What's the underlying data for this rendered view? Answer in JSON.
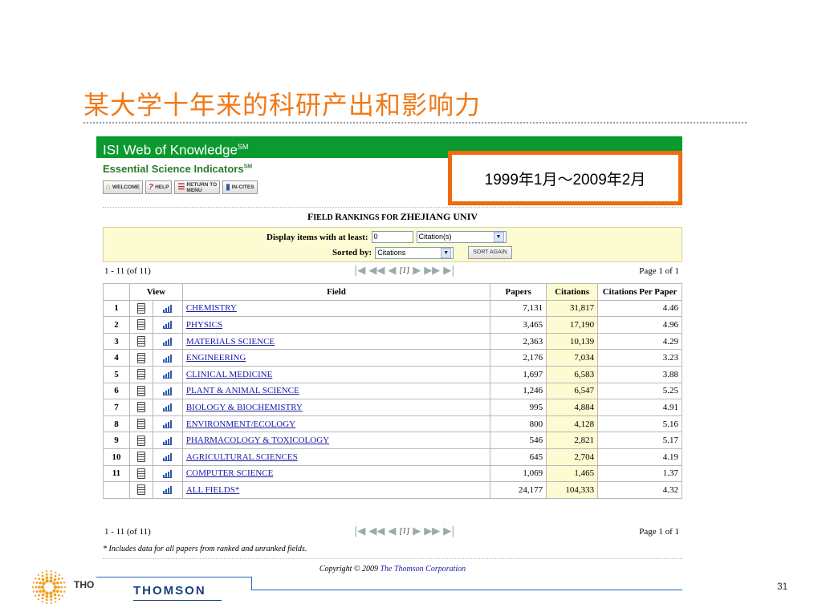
{
  "slide": {
    "title": "某大学十年来的科研产出和影响力",
    "date_range": "1999年1月～2009年2月",
    "page_number": "31"
  },
  "isi": {
    "title": "ISI Web of Knowledge",
    "title_mark": "SM",
    "subtitle": "Essential Science Indicators",
    "subtitle_mark": "SM",
    "buttons": [
      {
        "label": "WELCOME",
        "icon": "home-icon"
      },
      {
        "label": "HELP",
        "icon": "question-icon"
      },
      {
        "label_line1": "RETURN TO",
        "label_line2": "MENU",
        "icon": "menu-icon"
      },
      {
        "label": "IN-CITES",
        "icon": "book-icon"
      }
    ]
  },
  "rankings": {
    "heading_big_1": "F",
    "heading_small_1": "IELD ",
    "heading_big_2": "R",
    "heading_small_2": "ANKINGS FOR ",
    "heading_name": "ZHEJIANG UNIV",
    "display_label": "Display items with at least:",
    "display_value": "0",
    "display_unit": "Citation(s)",
    "sorted_label": "Sorted by:",
    "sorted_value": "Citations",
    "sort_button": "SORT AGAIN",
    "range_text": "1 - 11 (of 11)",
    "page_text": "Page 1 of 1",
    "current_page": "[1]",
    "columns": {
      "view": "View",
      "field": "Field",
      "papers": "Papers",
      "citations": "Citations",
      "cpp": "Citations Per Paper"
    },
    "rows": [
      {
        "rank": "1",
        "field": "CHEMISTRY",
        "papers": "7,131",
        "citations": "31,817",
        "cpp": "4.46"
      },
      {
        "rank": "2",
        "field": "PHYSICS",
        "papers": "3,465",
        "citations": "17,190",
        "cpp": "4.96"
      },
      {
        "rank": "3",
        "field": "MATERIALS SCIENCE",
        "papers": "2,363",
        "citations": "10,139",
        "cpp": "4.29"
      },
      {
        "rank": "4",
        "field": "ENGINEERING",
        "papers": "2,176",
        "citations": "7,034",
        "cpp": "3.23"
      },
      {
        "rank": "5",
        "field": "CLINICAL MEDICINE",
        "papers": "1,697",
        "citations": "6,583",
        "cpp": "3.88"
      },
      {
        "rank": "6",
        "field": "PLANT & ANIMAL SCIENCE",
        "papers": "1,246",
        "citations": "6,547",
        "cpp": "5.25"
      },
      {
        "rank": "7",
        "field": "BIOLOGY & BIOCHEMISTRY",
        "papers": "995",
        "citations": "4,884",
        "cpp": "4.91"
      },
      {
        "rank": "8",
        "field": "ENVIRONMENT/ECOLOGY",
        "papers": "800",
        "citations": "4,128",
        "cpp": "5.16"
      },
      {
        "rank": "9",
        "field": "PHARMACOLOGY & TOXICOLOGY",
        "papers": "546",
        "citations": "2,821",
        "cpp": "5.17"
      },
      {
        "rank": "10",
        "field": "AGRICULTURAL SCIENCES",
        "papers": "645",
        "citations": "2,704",
        "cpp": "4.19"
      },
      {
        "rank": "11",
        "field": "COMPUTER SCIENCE",
        "papers": "1,069",
        "citations": "1,465",
        "cpp": "1.37"
      },
      {
        "rank": "",
        "field": "ALL FIELDS*",
        "papers": "24,177",
        "citations": "104,333",
        "cpp": "4.32"
      }
    ],
    "footnote": "* Includes data for all papers from ranked and unranked fields.",
    "copyright_prefix": "Copyright © 2009 ",
    "copyright_link": "The Thomson Corporation"
  },
  "footer": {
    "logo_left_text": "THO",
    "logo_main_text": "THOMSON"
  },
  "colors": {
    "title_orange": "#f07a1a",
    "isi_green": "#0a9a2e",
    "highlight_yellow": "#fdfbd2",
    "link_blue": "#1a1aa6",
    "box_orange": "#f06b10"
  }
}
